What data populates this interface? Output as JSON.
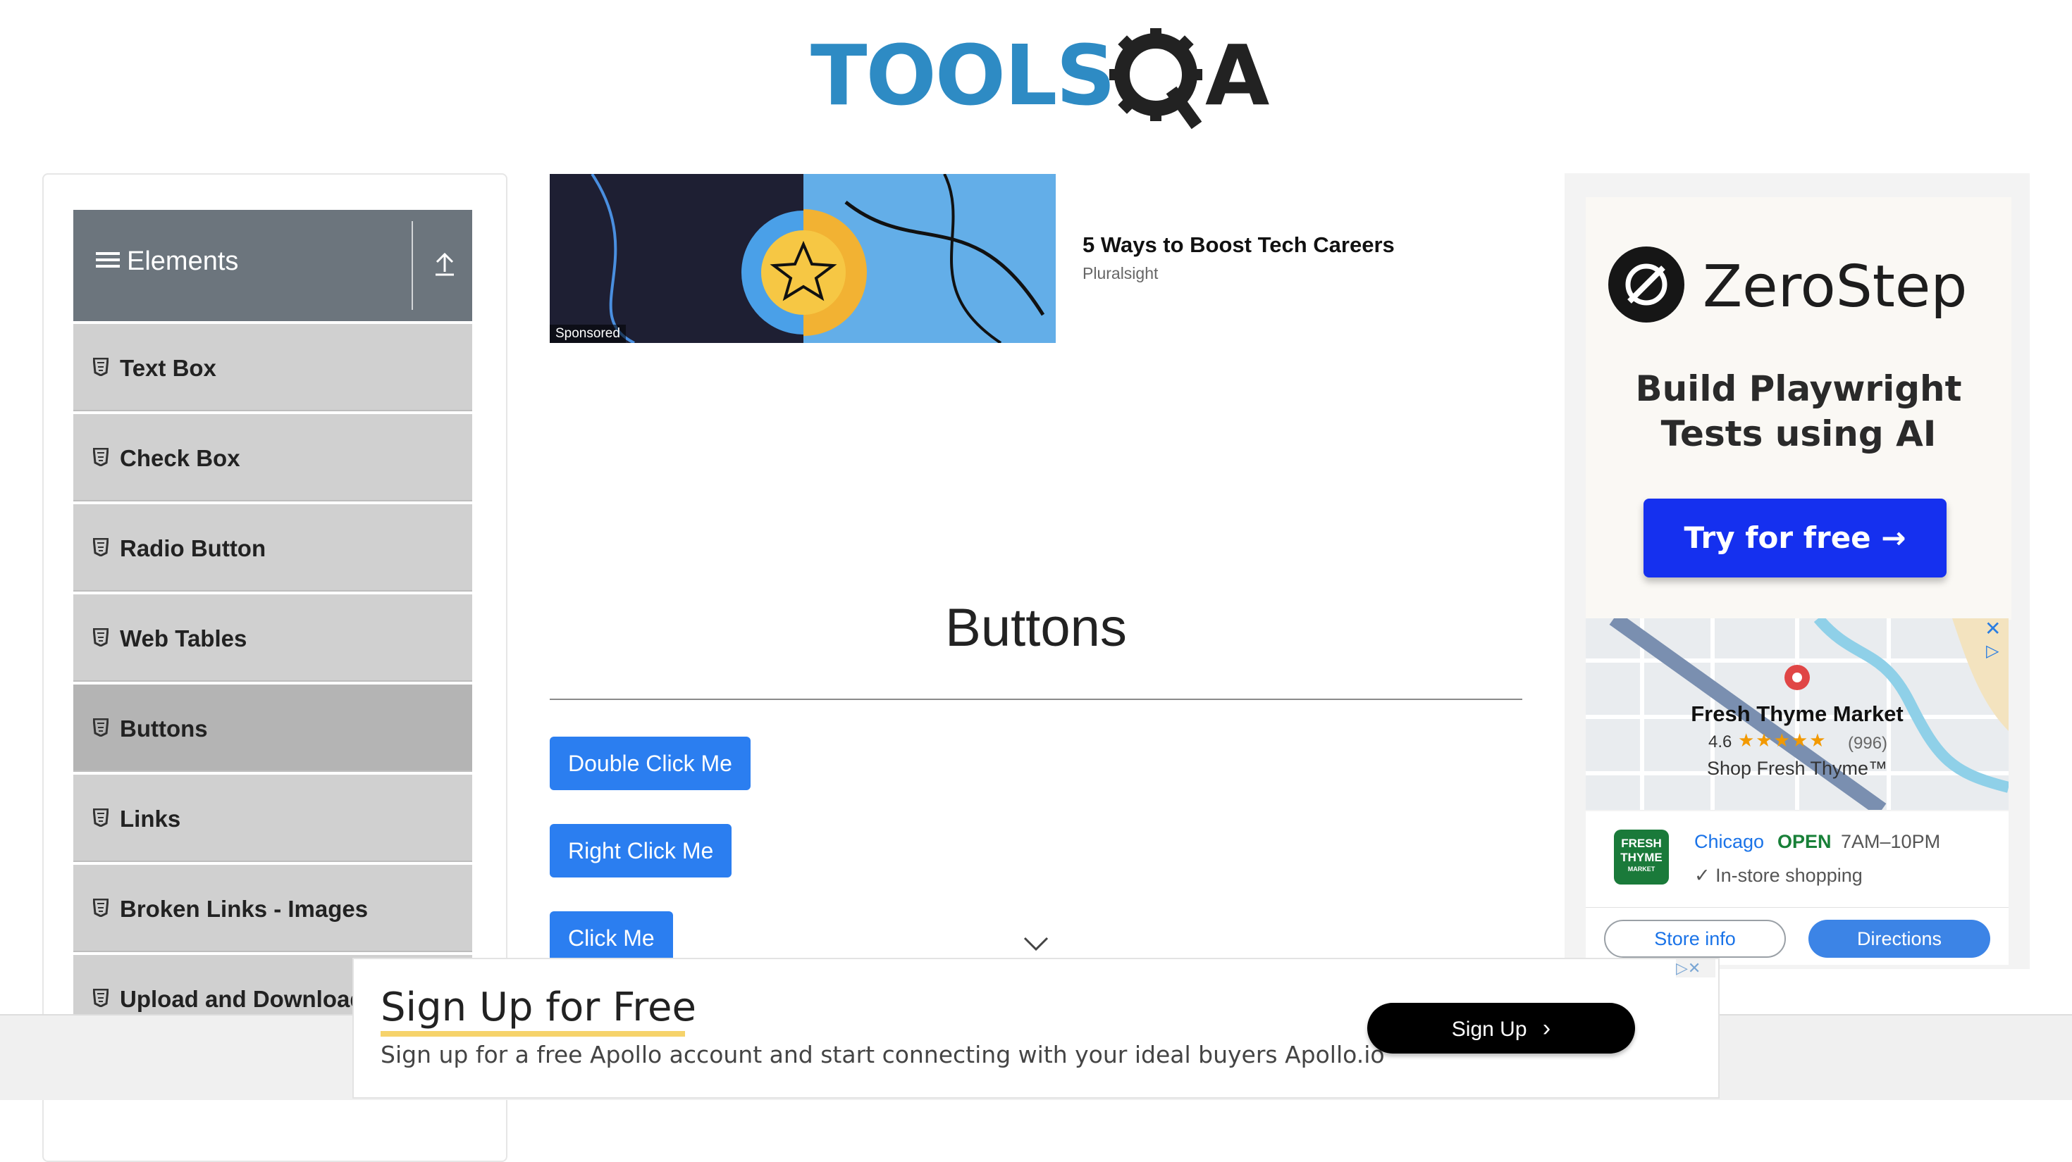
{
  "header": {
    "logo_text": "TOOLS",
    "logo_text2": "QA"
  },
  "sidebar": {
    "group_title": "Elements",
    "items": [
      {
        "label": "Text Box"
      },
      {
        "label": "Check Box"
      },
      {
        "label": "Radio Button"
      },
      {
        "label": "Web Tables"
      },
      {
        "label": "Buttons",
        "active": true
      },
      {
        "label": "Links"
      },
      {
        "label": "Broken Links - Images"
      },
      {
        "label": "Upload and Download"
      }
    ]
  },
  "sponsored_top": {
    "tag": "Sponsored",
    "title": "5 Ways to Boost Tech Careers",
    "source": "Pluralsight"
  },
  "main": {
    "heading": "Buttons",
    "buttons": [
      "Double Click Me",
      "Right Click Me",
      "Click Me"
    ]
  },
  "right_ad": {
    "brand": "ZeroStep",
    "tagline_line1": "Build Playwright",
    "tagline_line2": "Tests using AI",
    "cta": "Try for free →",
    "store": {
      "name": "Fresh Thyme Market",
      "rating": "4.6",
      "stars": "★★★★★",
      "reviews": "(996)",
      "shop": "Shop Fresh Thyme™",
      "logo_text": "FRESH THYME",
      "logo_sub": "MARKET",
      "city": "Chicago",
      "status": "OPEN",
      "hours": "7AM–10PM",
      "instore": "✓ In-store shopping",
      "store_info": "Store info",
      "directions": "Directions"
    }
  },
  "bottom_ad": {
    "title": "Sign Up for Free",
    "subtitle": "Sign up for a free Apollo account and start connecting with your ideal buyers Apollo.io",
    "cta": "Sign Up",
    "cta_icon": "›"
  },
  "colors": {
    "primary_button": "#2b7ef0",
    "sidebar_header": "#6c757d",
    "brand_blue": "#2e8bc4"
  }
}
